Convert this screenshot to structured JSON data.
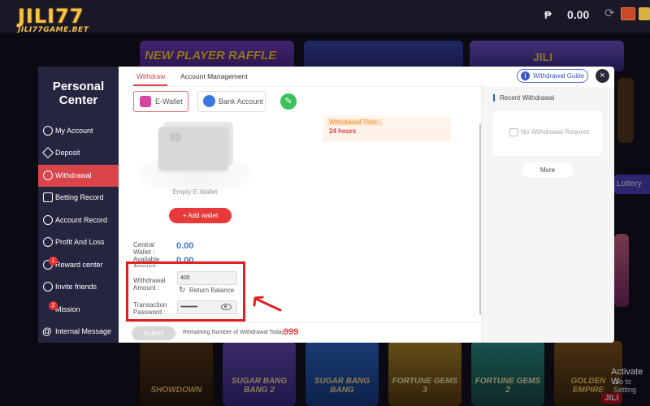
{
  "site": {
    "logo": "JILI77",
    "logo_domain": "JILI77GAME.BET",
    "currency_symbol": "₱",
    "balance": "0.00",
    "banners": [
      "NEW PLAYER RAFFLE",
      "JILI"
    ],
    "lottery_label": "Lottery",
    "games": [
      "SHOWDOWN",
      "SUGAR BANG BANG 2",
      "SUGAR BANG BANG",
      "FORTUNE GEMS 3",
      "FORTUNE GEMS 2",
      "GOLDEN EMPIRE"
    ],
    "provider_tag": "JILI",
    "os_notice": "Activate W",
    "os_notice_sub": "Go to Setting"
  },
  "sidebar": {
    "title": "Personal Center",
    "items": [
      {
        "label": "My Account"
      },
      {
        "label": "Deposit"
      },
      {
        "label": "Withdrawal"
      },
      {
        "label": "Betting Record"
      },
      {
        "label": "Account Record"
      },
      {
        "label": "Profit And Loss"
      },
      {
        "label": "Reward center",
        "badge": "1"
      },
      {
        "label": "Invite friends"
      },
      {
        "label": "Mission",
        "badge": "2"
      },
      {
        "label": "Internal Message"
      }
    ]
  },
  "tabs": {
    "withdraw": "Withdraw",
    "account_management": "Account Management"
  },
  "header": {
    "guide_label": "Withdrawal Guide",
    "close_glyph": "×"
  },
  "wallet_tabs": {
    "ewallet": "E-Wallet",
    "bank": "Bank Account",
    "edit_glyph": "✎"
  },
  "wallet": {
    "empty_label": "Empty E-Wallet",
    "add_label": "+ Add wallet"
  },
  "notice": {
    "label": "Withdrawal Time :",
    "value": "24 hours"
  },
  "form": {
    "central_wallet_label": "Central Wallet :",
    "central_wallet_value": "0.00",
    "available_label": "Available Amount :",
    "available_value": "0.00",
    "amount_label": "Withdrawal Amount :",
    "amount_value": "400",
    "return_balance_label": "Return Balance",
    "password_label": "Transaction Password :",
    "password_value": "••••••••••••••"
  },
  "footer": {
    "submit_label": "Submit",
    "remaining_label": "Remaining Number of Withdrawal Today :",
    "remaining_value": "999"
  },
  "recent": {
    "title": "Recent Withdrawal",
    "empty_label": "No Withdrawal Request",
    "more_label": "More"
  },
  "colors": {
    "accent_red": "#d9444a",
    "sidebar_bg": "#262540",
    "link_blue": "#3b55c8",
    "annotation_red": "#e02020"
  }
}
